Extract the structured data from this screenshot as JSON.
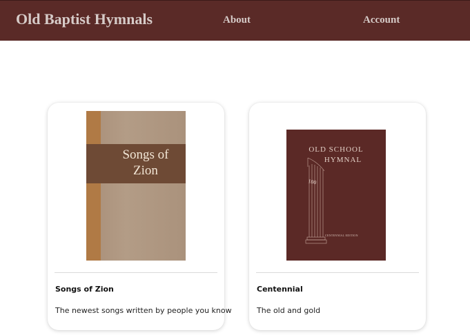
{
  "navbar": {
    "brand": "Old Baptist Hymnals",
    "links": [
      {
        "label": "About"
      },
      {
        "label": "Account"
      }
    ]
  },
  "colors": {
    "navbar_bg": "#5a2a27",
    "nav_text": "#d6cbc8",
    "zion_band": "#6e4a35",
    "hymnal_cover": "#5b2926"
  },
  "hymnals": [
    {
      "title": "Songs of Zion",
      "description": "The newest songs written by people you know",
      "cover": {
        "line1": "Songs of",
        "line2": "Zion"
      }
    },
    {
      "title": "Centennial",
      "description": "The old and gold",
      "cover": {
        "line1": "OLD SCHOOL",
        "line2": "HYMNAL",
        "column_number": "100",
        "edition": "CENTENNIAL EDITION"
      }
    }
  ]
}
